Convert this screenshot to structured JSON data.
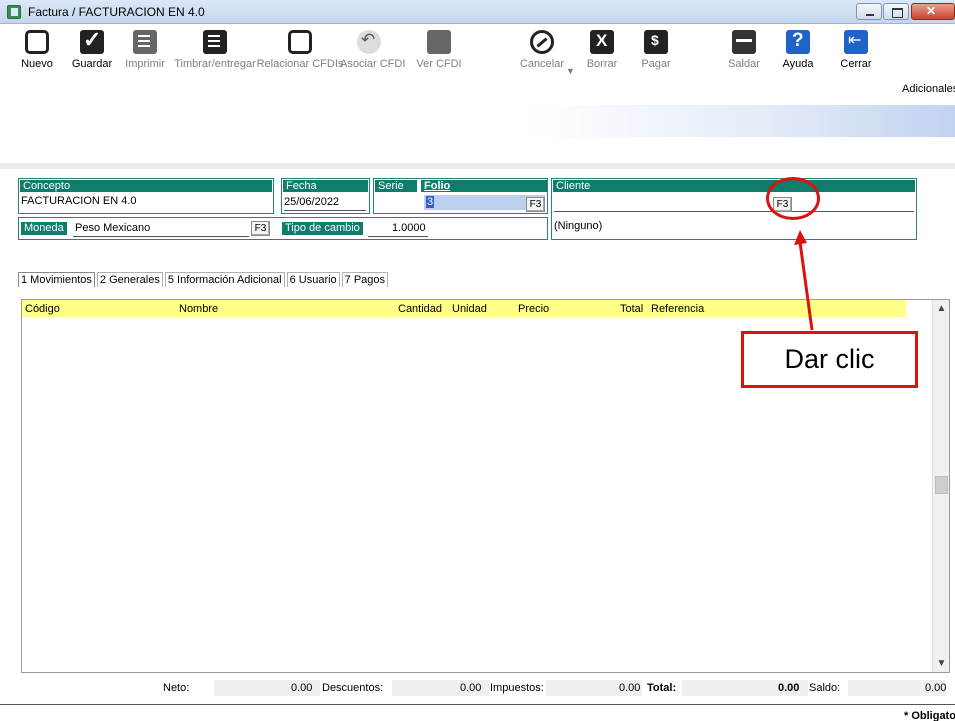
{
  "window": {
    "title": "Factura / FACTURACION EN 4.0"
  },
  "toolbar": {
    "items": [
      {
        "label": "Nuevo",
        "icon": "new-document-icon"
      },
      {
        "label": "Guardar",
        "icon": "save-check-icon"
      },
      {
        "label": "Imprimir",
        "icon": "print-icon"
      },
      {
        "label": "Timbrar/entregar",
        "icon": "stamp-icon"
      },
      {
        "label": "Relacionar CFDIs",
        "icon": "relate-icon"
      },
      {
        "label": "Asociar CFDI",
        "icon": "associate-icon"
      },
      {
        "label": "Ver CFDI",
        "icon": "view-cfdi-icon"
      },
      {
        "label": "Cancelar",
        "icon": "cancel-icon"
      },
      {
        "label": "Borrar",
        "icon": "delete-icon"
      },
      {
        "label": "Pagar",
        "icon": "pay-icon"
      },
      {
        "label": "Saldar",
        "icon": "settle-icon"
      },
      {
        "label": "Ayuda",
        "icon": "help-icon"
      },
      {
        "label": "Cerrar",
        "icon": "close-door-icon"
      }
    ],
    "adicionales": "Adicionales"
  },
  "form": {
    "concepto_label": "Concepto",
    "concepto_value": "FACTURACION EN 4.0",
    "fecha_label": "Fecha",
    "fecha_value": "25/06/2022",
    "serie_label": "Serie",
    "folio_label": "Folio",
    "folio_value": "3",
    "cliente_label": "Cliente",
    "cliente_value": "",
    "cliente_name": "(Ninguno)",
    "moneda_label": "Moneda",
    "moneda_value": "Peso Mexicano",
    "tipo_cambio_label": "Tipo de cambio",
    "tipo_cambio_value": "1.0000",
    "f3_label": "F3"
  },
  "tabs": [
    {
      "label": "1 Movimientos"
    },
    {
      "label": "2 Generales"
    },
    {
      "label": "5 Información Adicional"
    },
    {
      "label": "6 Usuario"
    },
    {
      "label": "7 Pagos"
    }
  ],
  "grid": {
    "columns": [
      "Código",
      "Nombre",
      "Cantidad",
      "Unidad",
      "Precio",
      "Total",
      "Referencia"
    ]
  },
  "totals": {
    "neto_label": "Neto:",
    "neto_value": "0.00",
    "descuentos_label": "Descuentos:",
    "descuentos_value": "0.00",
    "impuestos_label": "Impuestos:",
    "impuestos_value": "0.00",
    "total_label": "Total:",
    "total_value": "0.00",
    "saldo_label": "Saldo:",
    "saldo_value": "0.00"
  },
  "status": {
    "obligatorio": "* Obligatorio"
  },
  "annotation": {
    "text": "Dar clic",
    "color": "#e01010"
  },
  "colors": {
    "panel_header": "#0f7c6c",
    "grid_header": "#ffff88",
    "folio_selection": "#2f5fc8"
  }
}
